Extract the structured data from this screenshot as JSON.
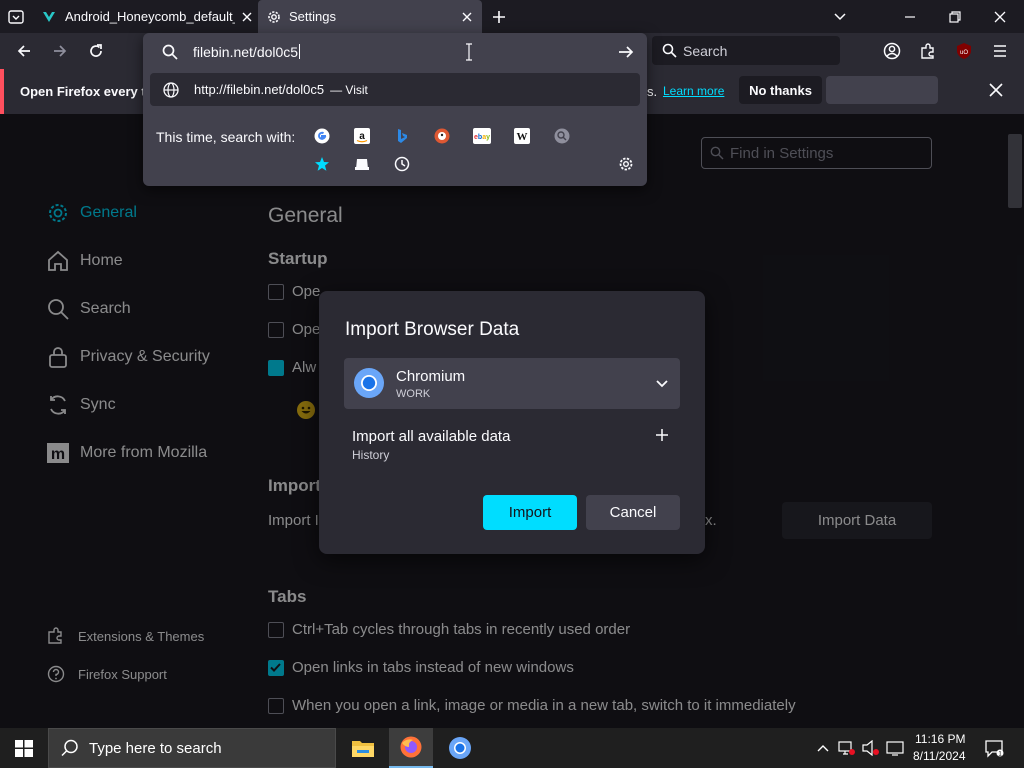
{
  "tabs": [
    {
      "title": "Android_Honeycomb_default_w"
    },
    {
      "title": "Settings"
    }
  ],
  "urlbar": {
    "value": "filebin.net/dol0c5",
    "suggestion_url": "http://filebin.net/dol0c5",
    "suggestion_action": "— Visit",
    "search_with_label": "This time, search with:"
  },
  "search": {
    "placeholder": "Search"
  },
  "notification": {
    "text": "Open Firefox every ti",
    "fragment": "s.",
    "learn_more": "Learn more",
    "no_thanks": "No thanks"
  },
  "settings": {
    "find_placeholder": "Find in Settings",
    "page_title": "General",
    "startup_heading": "Startup",
    "startup_row1": "Ope",
    "startup_row2": "Ope",
    "startup_row3": "Alw",
    "import_heading": "Import",
    "import_desc": "Import I",
    "import_desc_tail": "x.",
    "import_data_button": "Import Data",
    "tabs_heading": "Tabs",
    "tabs_rows": [
      {
        "label": "Ctrl+Tab cycles through tabs in recently used order",
        "checked": false
      },
      {
        "label": "Open links in tabs instead of new windows",
        "checked": true
      },
      {
        "label": "When you open a link, image or media in a new tab, switch to it immediately",
        "checked": false
      }
    ]
  },
  "sidebar": {
    "items": [
      {
        "label": "General",
        "icon": "gear-icon",
        "active": true
      },
      {
        "label": "Home",
        "icon": "home-icon"
      },
      {
        "label": "Search",
        "icon": "search-icon"
      },
      {
        "label": "Privacy & Security",
        "icon": "lock-icon"
      },
      {
        "label": "Sync",
        "icon": "sync-icon"
      },
      {
        "label": "More from Mozilla",
        "icon": "mozilla-icon"
      }
    ],
    "footer": [
      {
        "label": "Extensions & Themes",
        "icon": "puzzle-icon"
      },
      {
        "label": "Firefox Support",
        "icon": "help-icon"
      }
    ]
  },
  "dialog": {
    "title": "Import Browser Data",
    "browser_name": "Chromium",
    "profile": "WORK",
    "import_all": "Import all available data",
    "import_detail": "History",
    "import_button": "Import",
    "cancel_button": "Cancel"
  },
  "taskbar": {
    "search_placeholder": "Type here to search",
    "time": "11:16 PM",
    "date": "8/11/2024"
  },
  "colors": {
    "accent": "#00ddff",
    "background": "#1c1b22",
    "panel": "#2b2a33",
    "notification_border": "#ff4f5e"
  }
}
